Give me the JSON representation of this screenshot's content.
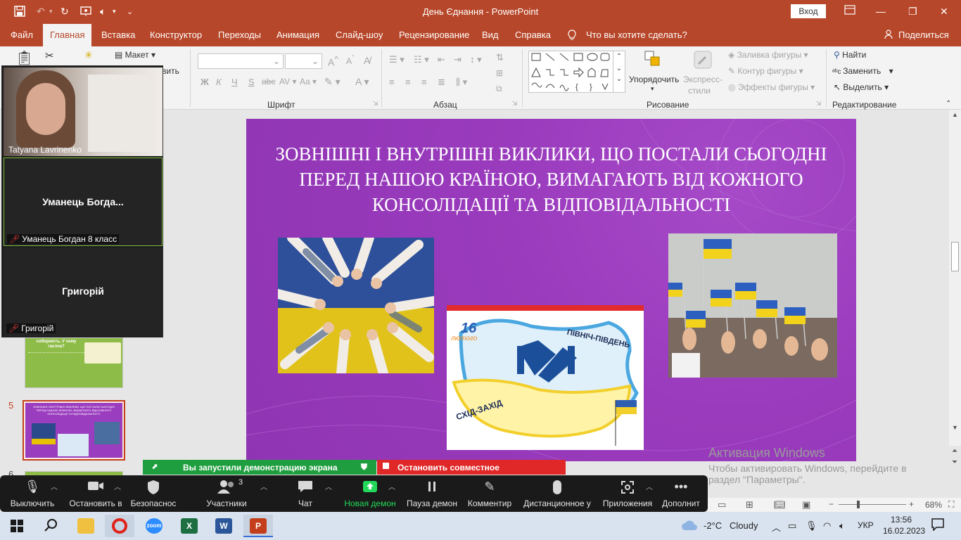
{
  "window": {
    "title": "День Єднання - PowerPoint",
    "signin_label": "Вход"
  },
  "tabs": [
    {
      "label": "Файл"
    },
    {
      "label": "Главная"
    },
    {
      "label": "Вставка"
    },
    {
      "label": "Конструктор"
    },
    {
      "label": "Переходы"
    },
    {
      "label": "Анимация"
    },
    {
      "label": "Слайд-шоу"
    },
    {
      "label": "Рецензирование"
    },
    {
      "label": "Вид"
    },
    {
      "label": "Справка"
    },
    {
      "label": "Что вы хотите сделать?"
    },
    {
      "label": "Поделиться"
    }
  ],
  "ribbon": {
    "layout_label": "Макет",
    "font_group": "Шрифт",
    "paragraph_group": "Абзац",
    "drawing_group": "Рисование",
    "editing_group": "Редактирование",
    "arrange_label": "Упорядочить",
    "quick_styles_label_1": "Экспресс-",
    "quick_styles_label_2": "стили",
    "shape_fill": "Заливка фигуры",
    "shape_outline": "Контур фигуры",
    "shape_effects": "Эффекты фигуры",
    "find": "Найти",
    "replace": "Заменить",
    "select": "Выделить",
    "bold": "Ж",
    "italic": "К",
    "underline": "Ч",
    "strike": "S",
    "text_cut": "вить"
  },
  "slide": {
    "title": "Зовнішні і внутрішні виклики, що постали сьогодні перед нашою країною, вимагають від кожного консолідації та відповідальності",
    "poster_date_num": "16",
    "poster_date_month": "лютого",
    "poster_north_south": "ПІВНІЧ-ПІВДЕНЬ",
    "poster_east_west": "СХІД-ЗАХІД"
  },
  "thumbnails": [
    {
      "number": "5"
    },
    {
      "number": "6"
    }
  ],
  "thumb4_text": "соборність. У чому гаслоа?",
  "thumb5_text": "ЗОВНІШНІ І ВНУТРІШНІ ВИКЛИКИ, ЩО ПОСТАЛИ СЬОГОДНІ ПЕРЕД НАШОЮ КРАЇНОЮ, ВИМАГАЮТЬ ВІД КОЖНОГО КОНСОЛІДАЦІЇ ТА ВІДПОВІДАЛЬНОСТІ",
  "zoom_participants": [
    {
      "name": "Tatyana Lavrinenko"
    },
    {
      "display": "Уманець  Богда...",
      "name": "Уманець Богдан 8 класс"
    },
    {
      "display": "Григорій",
      "name": "Григорій"
    }
  ],
  "share": {
    "started": "Вы запустили демонстрацию экрана",
    "stop": "Остановить совместное использование"
  },
  "zoom_toolbar": [
    {
      "label": "Выключить",
      "icon": "microphone-icon"
    },
    {
      "label": "Остановить в",
      "icon": "video-camera-icon"
    },
    {
      "label": "Безопаснос",
      "icon": "shield-icon"
    },
    {
      "label": "Участники",
      "icon": "participants-icon",
      "count": "3"
    },
    {
      "label": "Чат",
      "icon": "chat-icon"
    },
    {
      "label": "Новая демон",
      "icon": "share-screen-icon"
    },
    {
      "label": "Пауза демон",
      "icon": "pause-icon"
    },
    {
      "label": "Комментир",
      "icon": "pencil-icon"
    },
    {
      "label": "Дистанционное у",
      "icon": "mouse-icon"
    },
    {
      "label": "Приложения",
      "icon": "apps-icon"
    },
    {
      "label": "Дополнит",
      "icon": "more-icon"
    }
  ],
  "activation": {
    "title": "Активация Windows",
    "line1": "Чтобы активировать Windows, перейдите в",
    "line2": "раздел \"Параметры\"."
  },
  "statusbar": {
    "zoom_level": "68%"
  },
  "taskbar": {
    "weather_temp": "-2°C",
    "weather_desc": "Cloudy",
    "lang": "УКР",
    "time": "13:56",
    "date": "16.02.2023"
  },
  "colors": {
    "accent": "#b7472a",
    "slide_bg": "#9b3dbf",
    "share_green": "#1f9e3f",
    "share_red": "#e02828"
  }
}
